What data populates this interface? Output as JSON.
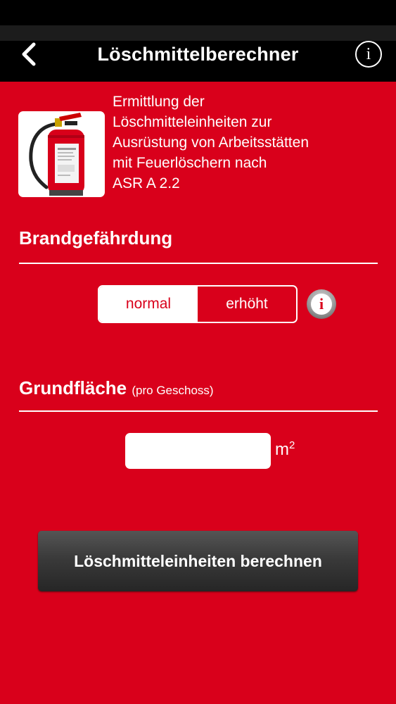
{
  "nav": {
    "title": "Löschmittelberechner",
    "back_icon": "chevron-left-icon",
    "info_label": "i"
  },
  "intro": {
    "text": "Ermittlung der\nLöschmitteleinheiten zur\nAusrüstung von Arbeitsstätten\nmit Feuerlöschern nach\nASR A 2.2",
    "image": "fire-extinguisher-image"
  },
  "hazard": {
    "title": "Brandgefährdung",
    "options": [
      "normal",
      "erhöht"
    ],
    "selected": "normal",
    "info_label": "i"
  },
  "area": {
    "title": "Grundfläche",
    "subtitle": "(pro Geschoss)",
    "input_value": "",
    "input_placeholder": "",
    "unit": "m",
    "unit_exponent": "2"
  },
  "action": {
    "button_label": "Löschmitteleinheiten berechnen"
  },
  "colors": {
    "background": "#d9001b",
    "navbar": "#000000",
    "button": "#333333"
  }
}
